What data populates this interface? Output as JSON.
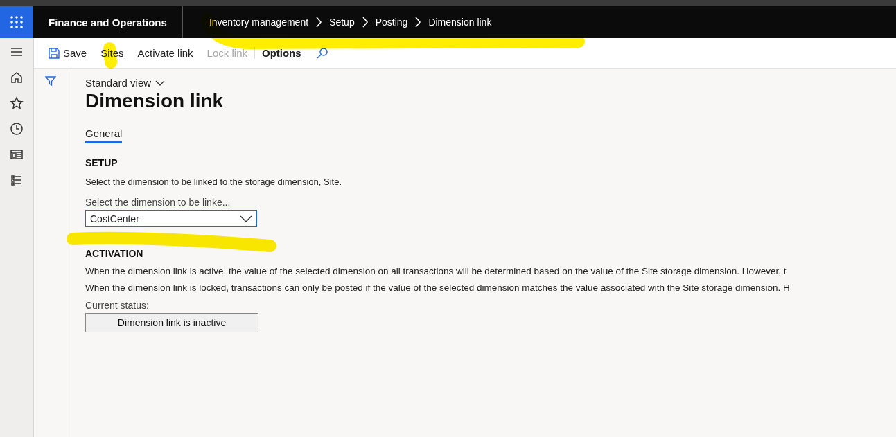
{
  "app": {
    "title": "Finance and Operations"
  },
  "breadcrumb": [
    "Inventory management",
    "Setup",
    "Posting",
    "Dimension link"
  ],
  "toolbar": [
    {
      "label": "Save",
      "kind": "save",
      "disabled": false
    },
    {
      "label": "Sites",
      "kind": "plain",
      "disabled": false
    },
    {
      "label": "Activate link",
      "kind": "plain",
      "disabled": false
    },
    {
      "label": "Lock link",
      "kind": "plain",
      "disabled": true
    },
    {
      "label": "Options",
      "kind": "bold",
      "disabled": false
    }
  ],
  "view": {
    "label": "Standard view"
  },
  "page": {
    "title": "Dimension link"
  },
  "tabs": [
    {
      "label": "General",
      "selected": true
    }
  ],
  "setup": {
    "heading": "SETUP",
    "description": "Select the dimension to be linked to the storage dimension, Site.",
    "field_label": "Select the dimension to be linke...",
    "value": "CostCenter"
  },
  "activation": {
    "heading": "ACTIVATION",
    "lines": [
      "When the dimension link is active, the value of the selected dimension on all transactions will be determined based on the value of the Site storage dimension. However, t",
      "When the dimension link is locked, transactions can only be posted if the value of the selected dimension matches the value associated with the Site storage dimension. H"
    ],
    "status_label": "Current status:",
    "status_button": "Dimension link is inactive"
  }
}
